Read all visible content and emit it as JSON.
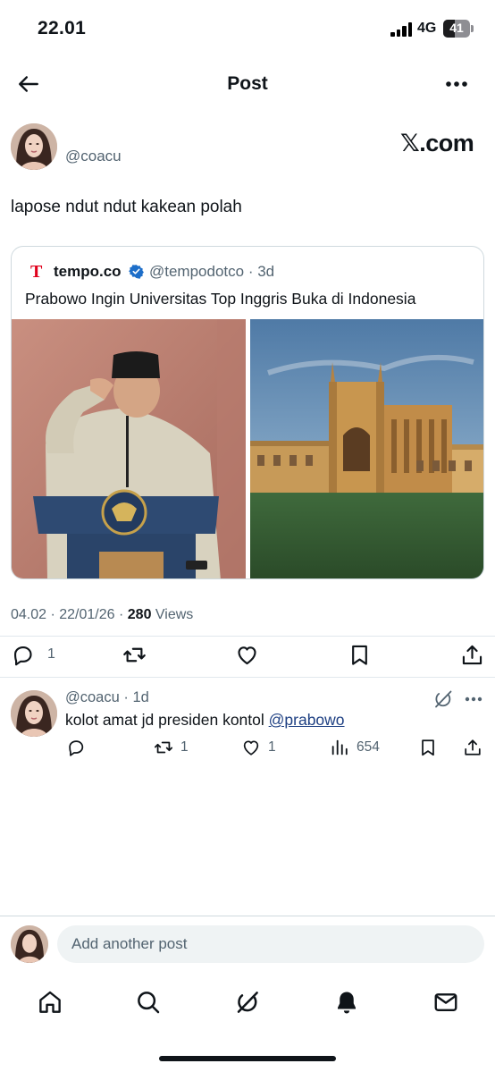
{
  "status_bar": {
    "time": "22.01",
    "network": "4G",
    "battery": "41"
  },
  "header": {
    "title": "Post",
    "back_icon": "arrow-left-icon",
    "more_icon": "more-horizontal-icon"
  },
  "post": {
    "handle": "@coacu",
    "watermark": "𝕏.com",
    "text": "lapose ndut ndut kakean polah",
    "timestamp": "04.02 · 22/01/26 · ",
    "views_count": "280",
    "views_label": " Views",
    "actions": {
      "replies": "1",
      "reposts": "",
      "likes": ""
    }
  },
  "quote": {
    "logo_letter": "T",
    "name": "tempo.co",
    "handle": "@tempodotco",
    "age": "3d",
    "text": "Prabowo Ingin Universitas Top Inggris Buka di Indonesia",
    "images": [
      "photo-speaker-saluting-at-podium",
      "photo-university-chapel-lawn"
    ]
  },
  "reply": {
    "handle": "@coacu",
    "age": "1d",
    "text": "kolot amat jd presiden kontol ",
    "mention": "@prabowo",
    "actions": {
      "replies": "",
      "reposts": "1",
      "likes": "1",
      "views": "654"
    }
  },
  "compose": {
    "placeholder": "Add another post"
  },
  "tabbar": [
    "home-icon",
    "search-icon",
    "grok-icon",
    "notifications-icon",
    "messages-icon"
  ],
  "colors": {
    "text": "#0f1419",
    "secondary": "#536471",
    "border": "#cfd9de",
    "verified": "#1d6ec9",
    "logo_red": "#e0001b"
  }
}
